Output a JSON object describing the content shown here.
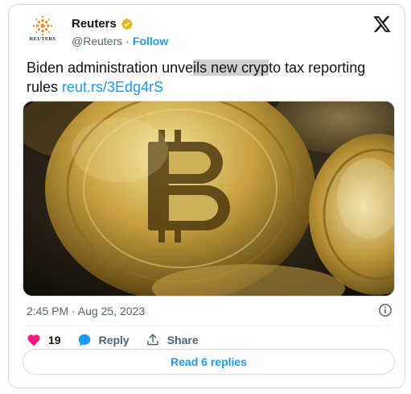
{
  "account": {
    "avatar_wordmark": "REUTERS",
    "display_name": "Reuters",
    "handle": "@Reuters",
    "separator": "·",
    "follow_label": "Follow"
  },
  "tweet": {
    "text_part1": "Biden administration unve",
    "text_highlight": "ils new cryp",
    "text_part2": "to tax reporting rules ",
    "link": "reut.rs/3Edg4rS",
    "image_subject": "gold bitcoin coins close-up",
    "timestamp": "2:45 PM · Aug 25, 2023"
  },
  "actions": {
    "like_count": "19",
    "reply_label": "Reply",
    "share_label": "Share"
  },
  "read_replies_label": "Read 6 replies",
  "icons": [
    "reuters-logo-icon",
    "verified-badge-icon",
    "x-logo-icon",
    "info-icon",
    "heart-icon",
    "reply-bubble-icon",
    "share-icon"
  ],
  "colors": {
    "link": "#1d9bf0",
    "like": "#f91880",
    "verified": "#e2b719",
    "muted": "#536471",
    "text": "#0f1419"
  }
}
